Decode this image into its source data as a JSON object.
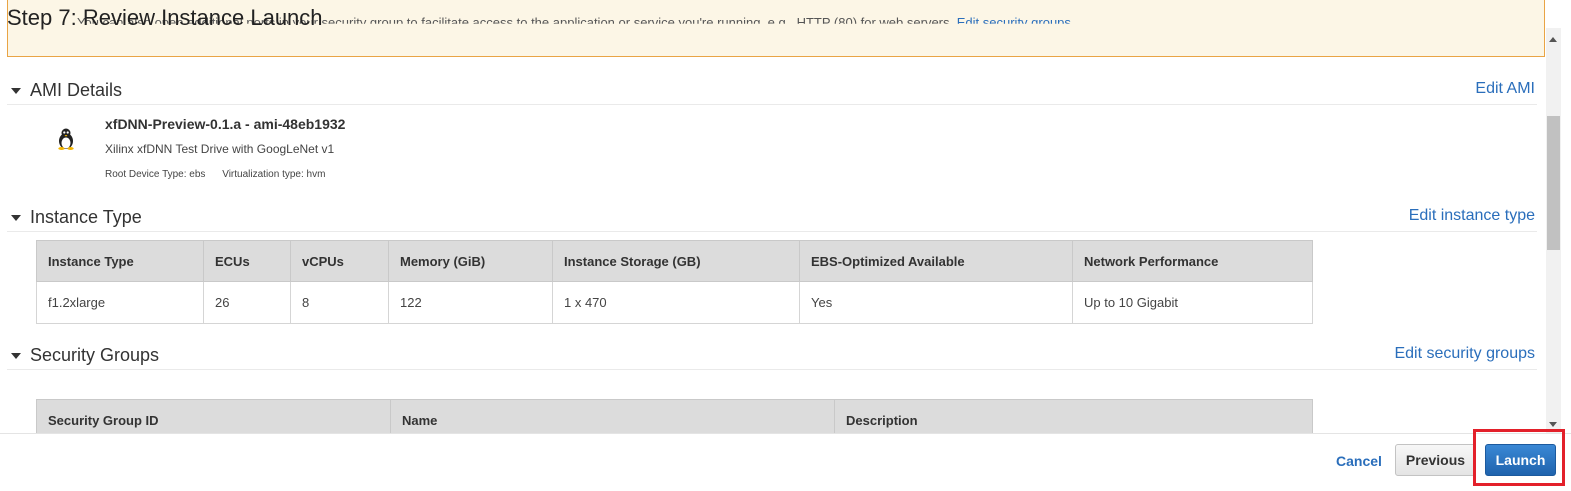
{
  "page": {
    "title": "Step 7: Review Instance Launch"
  },
  "warning": {
    "text": "You can also open additional ports in your security group to facilitate access to the application or service you're running, e.g., HTTP (80) for web servers.",
    "link": "Edit security groups"
  },
  "ami_section": {
    "title": "AMI Details",
    "edit_label": "Edit AMI",
    "icon": "linux-tux-icon",
    "name": "xfDNN-Preview-0.1.a - ami-48eb1932",
    "description": "Xilinx xfDNN Test Drive with GoogLeNet v1",
    "root_device": "Root Device Type: ebs",
    "virtualization": "Virtualization type: hvm"
  },
  "instance_section": {
    "title": "Instance Type",
    "edit_label": "Edit instance type",
    "columns": [
      "Instance Type",
      "ECUs",
      "vCPUs",
      "Memory (GiB)",
      "Instance Storage (GB)",
      "EBS-Optimized Available",
      "Network Performance"
    ],
    "row": [
      "f1.2xlarge",
      "26",
      "8",
      "122",
      "1 x 470",
      "Yes",
      "Up to 10 Gigabit"
    ]
  },
  "security_section": {
    "title": "Security Groups",
    "edit_label": "Edit security groups",
    "columns": [
      "Security Group ID",
      "Name",
      "Description"
    ]
  },
  "footer": {
    "cancel_label": "Cancel",
    "previous_label": "Previous",
    "launch_label": "Launch"
  },
  "colors": {
    "accent": "#2a6ebb",
    "launch_button": "#2b74c4",
    "highlight": "#e3202a",
    "warning_border": "#e9a445"
  }
}
